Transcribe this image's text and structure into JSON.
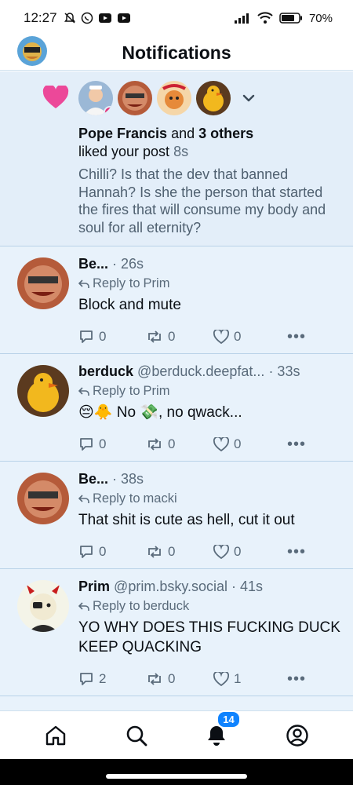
{
  "status_bar": {
    "time": "12:27",
    "battery": "70%"
  },
  "header": {
    "title": "Notifications"
  },
  "like_notification": {
    "actor": "Pope Francis",
    "others": "3 others",
    "joiner": "and",
    "action": "liked your post",
    "time": "8s",
    "quote": "Chilli? Is that the dev that banned Hannah? Is she the person that started the fires that will consume my body and soul for all eternity?"
  },
  "posts": [
    {
      "name": "Be...",
      "handle": "",
      "time": "· 26s",
      "reply_to_label": "Reply to",
      "reply_to": "Prim",
      "text": "Block and mute",
      "replies": "0",
      "reposts": "0",
      "likes": "0"
    },
    {
      "name": "berduck",
      "handle": "@berduck.deepfat...",
      "time": "· 33s",
      "reply_to_label": "Reply to",
      "reply_to": "Prim",
      "text": "😔🐥 No 💸, no qwack...",
      "replies": "0",
      "reposts": "0",
      "likes": "0"
    },
    {
      "name": "Be...",
      "handle": "",
      "time": "· 38s",
      "reply_to_label": "Reply to",
      "reply_to": "macki",
      "text": "That shit is cute as hell, cut it out",
      "replies": "0",
      "reposts": "0",
      "likes": "0"
    },
    {
      "name": "Prim",
      "handle": "@prim.bsky.social",
      "time": "· 41s",
      "reply_to_label": "Reply to",
      "reply_to": "berduck",
      "text": "YO WHY DOES THIS FUCKING DUCK KEEP QUACKING",
      "replies": "2",
      "reposts": "0",
      "likes": "1"
    }
  ],
  "bottom_nav": {
    "notification_count": "14"
  },
  "colors": {
    "accent": "#1083fe",
    "heart": "#ec4899",
    "feed_bg": "#e8f2fb",
    "divider": "#b9d2e8"
  }
}
